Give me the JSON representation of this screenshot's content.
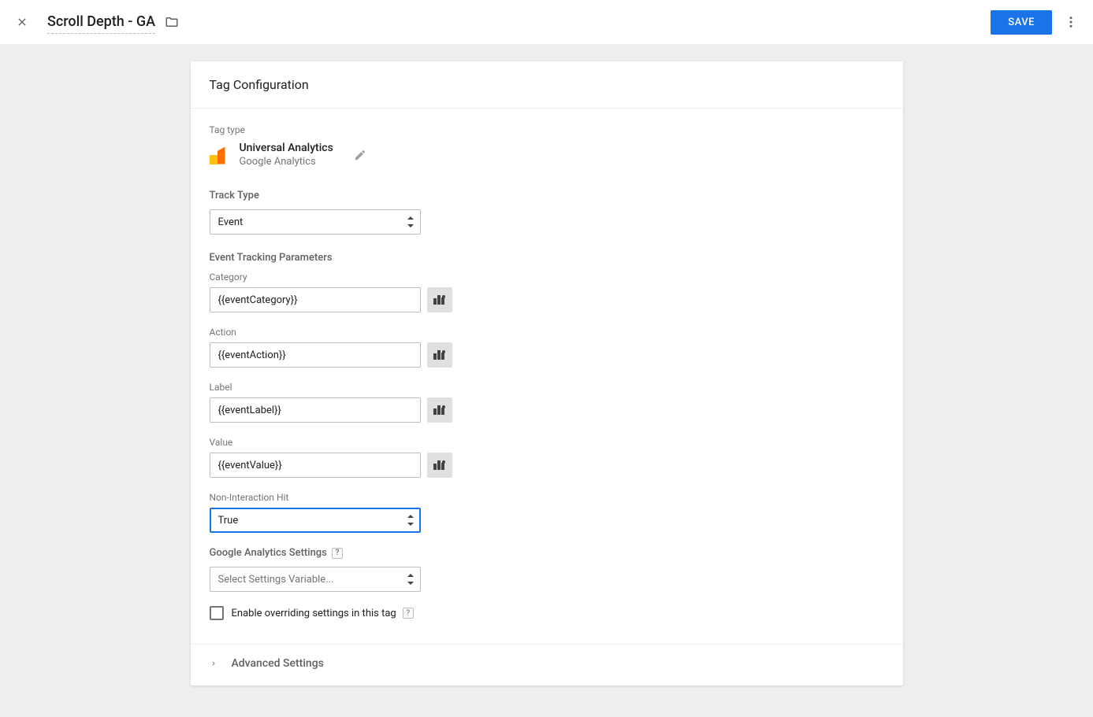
{
  "header": {
    "title": "Scroll Depth - GA",
    "save_label": "SAVE"
  },
  "card": {
    "title": "Tag Configuration",
    "tag_type_label": "Tag type",
    "tag_type": {
      "title": "Universal Analytics",
      "subtitle": "Google Analytics"
    },
    "track_type": {
      "label": "Track Type",
      "value": "Event"
    },
    "event_params_label": "Event Tracking Parameters",
    "fields": {
      "category": {
        "label": "Category",
        "value": "{{eventCategory}}"
      },
      "action": {
        "label": "Action",
        "value": "{{eventAction}}"
      },
      "label": {
        "label": "Label",
        "value": "{{eventLabel}}"
      },
      "value": {
        "label": "Value",
        "value": "{{eventValue}}"
      }
    },
    "non_interaction": {
      "label": "Non-Interaction Hit",
      "value": "True"
    },
    "ga_settings": {
      "label": "Google Analytics Settings",
      "placeholder": "Select Settings Variable..."
    },
    "override": {
      "label": "Enable overriding settings in this tag",
      "checked": false
    },
    "advanced_label": "Advanced Settings",
    "help_glyph": "?"
  }
}
